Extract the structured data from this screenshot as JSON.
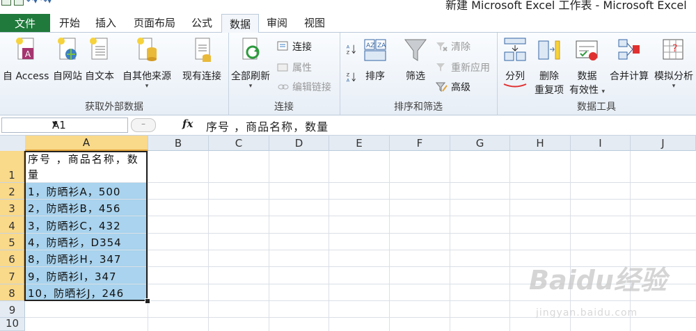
{
  "window": {
    "title": "新建 Microsoft Excel 工作表 - Microsoft Excel"
  },
  "tabs": {
    "file": "文件",
    "items": [
      "开始",
      "插入",
      "页面布局",
      "公式",
      "数据",
      "审阅",
      "视图"
    ],
    "active": "数据"
  },
  "ribbon": {
    "get_external": {
      "label": "获取外部数据",
      "buttons": [
        "自 Access",
        "自网站",
        "自文本",
        "自其他来源",
        "现有连接"
      ]
    },
    "connections": {
      "label": "连接",
      "refresh_all": "全部刷新",
      "connect": "连接",
      "properties": "属性",
      "edit_links": "编辑链接"
    },
    "sort_filter": {
      "label": "排序和筛选",
      "sort": "排序",
      "filter": "筛选",
      "clear": "清除",
      "reapply": "重新应用",
      "advanced": "高级"
    },
    "data_tools": {
      "label": "数据工具",
      "split": "分列",
      "remove_dup_1": "删除",
      "remove_dup_2": "重复项",
      "validation_1": "数据",
      "validation_2": "有效性",
      "consolidate": "合并计算",
      "whatif": "模拟分析"
    }
  },
  "formula_bar": {
    "name_box": "A1",
    "fx": "fx",
    "formula": "序号 ，商品名称，数量"
  },
  "sheet": {
    "columns": [
      "A",
      "B",
      "C",
      "D",
      "E",
      "F",
      "G",
      "H",
      "I",
      "J"
    ],
    "rows": [
      "1",
      "2",
      "3",
      "4",
      "5",
      "6",
      "7",
      "8",
      "9",
      "10"
    ],
    "cells": [
      "序号 ，商品名称，数量",
      "1，防晒衫A，500",
      "2，防晒衫B，456",
      "3，防晒衫C，432",
      "4，防晒衫，D354",
      "8，防晒衫H，347",
      "9，防晒衫I，347",
      "10，防晒衫J，246"
    ]
  },
  "watermark": {
    "logo": "Baidu经验",
    "url": "jingyan.baidu.com"
  },
  "colors": {
    "file_tab": "#1f7a3b",
    "selection": "#a9d3ee",
    "header_selected": "#f9d98a",
    "underline": "#e03030"
  }
}
